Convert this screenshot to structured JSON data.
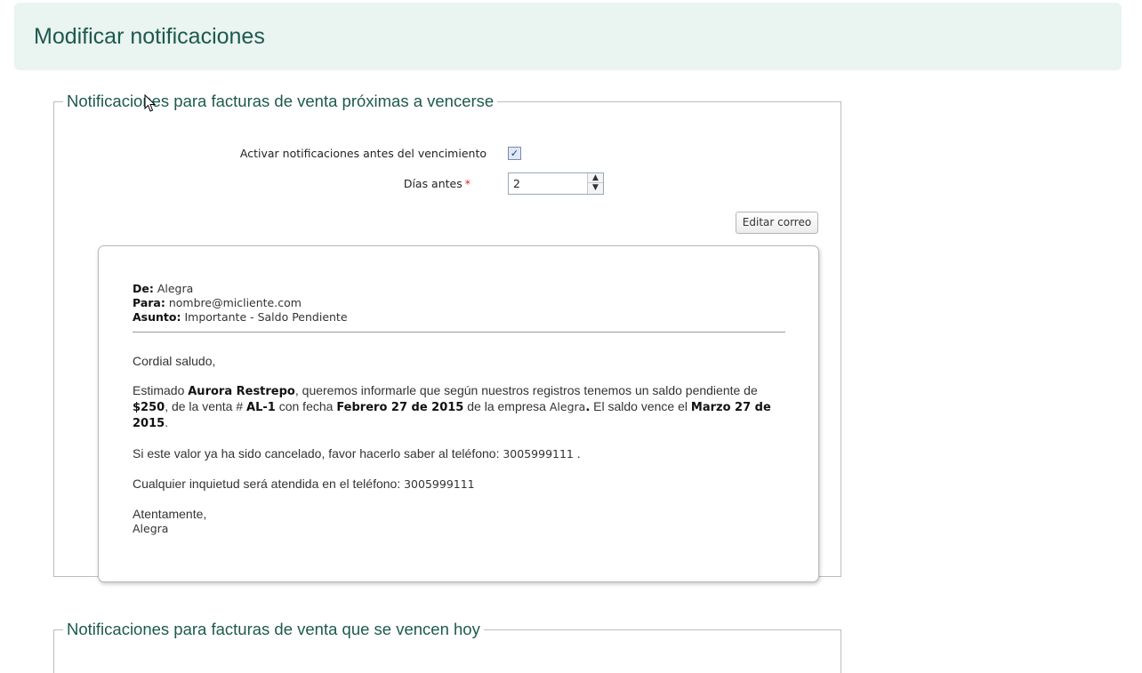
{
  "page": {
    "title": "Modificar notificaciones"
  },
  "section1": {
    "legend": "Notificaciones para facturas de venta próximas a vencerse",
    "activate_label": "Activar notificaciones antes del vencimiento",
    "activate_checked": true,
    "check_mark": "✓",
    "days_label": "Días antes",
    "required_mark": "*",
    "days_value": "2",
    "stepper_up": "▲",
    "stepper_down": "▼",
    "edit_button": "Editar correo"
  },
  "email": {
    "from_label": "De:",
    "from_value": "Alegra",
    "to_label": "Para:",
    "to_value": "nombre@micliente.com",
    "subject_label": "Asunto:",
    "subject_value": "Importante - Saldo Pendiente",
    "greeting": "Cordial saludo,",
    "p1_a": "Estimado ",
    "client_name": "Aurora Restrepo",
    "p1_b": ", queremos informarle que según nuestros registros tenemos un saldo pendiente de ",
    "amount": "$250",
    "p1_c": ", de la venta # ",
    "sale_number": "AL-1",
    "p1_d": " con fecha ",
    "sale_date": "Febrero 27 de 2015",
    "p1_e": " de la empresa ",
    "company": "Alegra",
    "p1_f": ".",
    "p1_g": "  El saldo vence el ",
    "due_date": "Marzo 27 de 2015",
    "p1_h": ".",
    "p2_a": "Si este valor ya ha sido cancelado, favor hacerlo saber al teléfono: ",
    "phone1": "3005999111",
    "p2_b": " .",
    "p3_a": "Cualquier inquietud será atendida en el teléfono: ",
    "phone2": "3005999111",
    "closing": "Atentamente,",
    "signature": "Alegra"
  },
  "section2": {
    "legend": "Notificaciones para facturas de venta que se vencen hoy"
  },
  "colors": {
    "header_bg": "#eaf4f1",
    "title": "#1d5a4c",
    "required": "#dd2222"
  }
}
